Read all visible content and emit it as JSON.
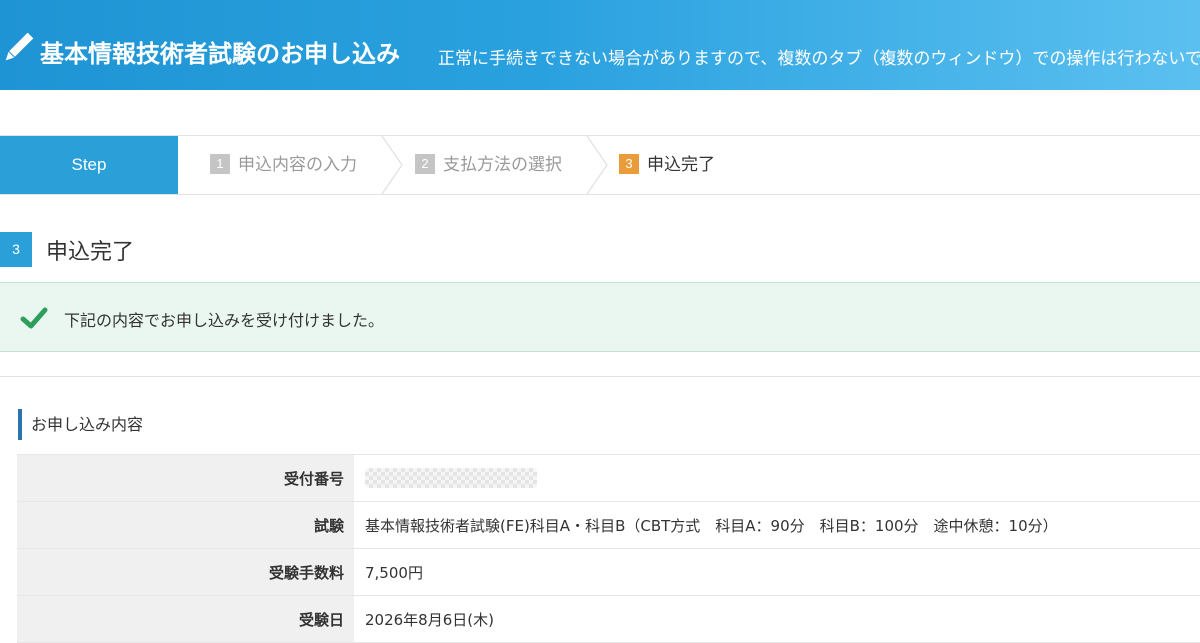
{
  "header": {
    "title": "基本情報技術者試験のお申し込み",
    "notice": "正常に手続きできない場合がありますので、複数のタブ（複数のウィンドウ）での操作は行わないでください。",
    "icon": "pencil-icon"
  },
  "steps": {
    "head_label": "Step",
    "items": [
      {
        "num": "1",
        "label": "申込内容の入力",
        "state": "done"
      },
      {
        "num": "2",
        "label": "支払方法の選択",
        "state": "done"
      },
      {
        "num": "3",
        "label": "申込完了",
        "state": "active"
      }
    ]
  },
  "section": {
    "badge": "3",
    "title": "申込完了"
  },
  "alert": {
    "icon": "checkmark-icon",
    "message": "下記の内容でお申し込みを受け付けました。"
  },
  "details": {
    "title": "お申し込み内容",
    "rows": [
      {
        "label": "受付番号",
        "value": ""
      },
      {
        "label": "試験",
        "value": "基本情報技術者試験(FE)科目A・科目B（CBT方式　科目A：90分　科目B：100分　途中休憩：10分）"
      },
      {
        "label": "受験手数料",
        "value": "7,500円"
      },
      {
        "label": "受験日",
        "value": "2026年8月6日(木)"
      }
    ]
  },
  "colors": {
    "header_start": "#1f94d4",
    "header_end": "#5bc0f0",
    "step_head": "#2a9fd8",
    "active_step_badge": "#ea9b3a",
    "alert_bg": "#eaf7f1",
    "check_green": "#2e9e5b",
    "subtitle_bar": "#2a74b0"
  }
}
